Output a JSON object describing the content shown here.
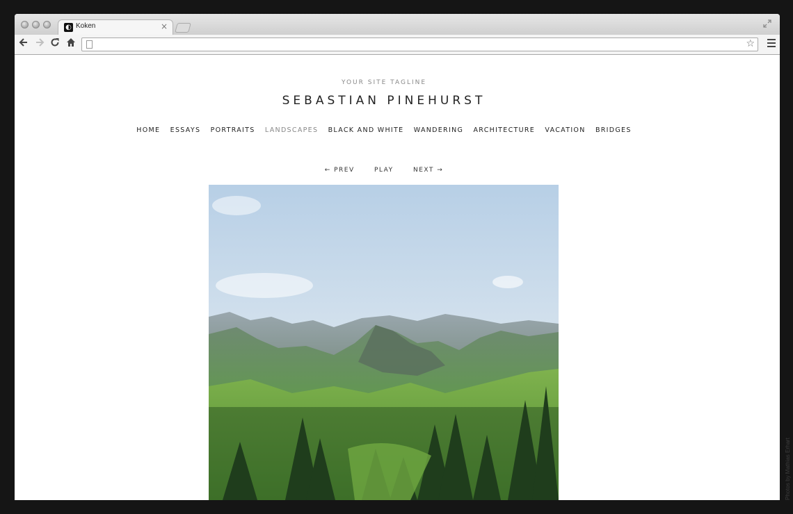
{
  "browser": {
    "tab_title": "Koken",
    "tab_close": "×",
    "address": "",
    "icons": [
      "back-icon",
      "forward-icon",
      "reload-icon",
      "home-icon",
      "page-icon",
      "star-icon",
      "menu-icon",
      "fullscreen-icon"
    ]
  },
  "site": {
    "tagline": "YOUR SITE TAGLINE",
    "title": "SEBASTIAN PINEHURST"
  },
  "nav": {
    "items": [
      "HOME",
      "ESSAYS",
      "PORTRAITS",
      "LANDSCAPES",
      "BLACK AND WHITE",
      "WANDERING",
      "ARCHITECTURE",
      "VACATION",
      "BRIDGES"
    ],
    "active": "LANDSCAPES"
  },
  "pager": {
    "prev": "← PREV",
    "play": "PLAY",
    "next": "NEXT →"
  },
  "photo": {
    "subject": "mountain landscape with pine forest"
  },
  "credit": "Photos by Mathias Erhart",
  "colors": {
    "backdrop": "#151515",
    "nav_active": "#888888",
    "text": "#222222"
  }
}
